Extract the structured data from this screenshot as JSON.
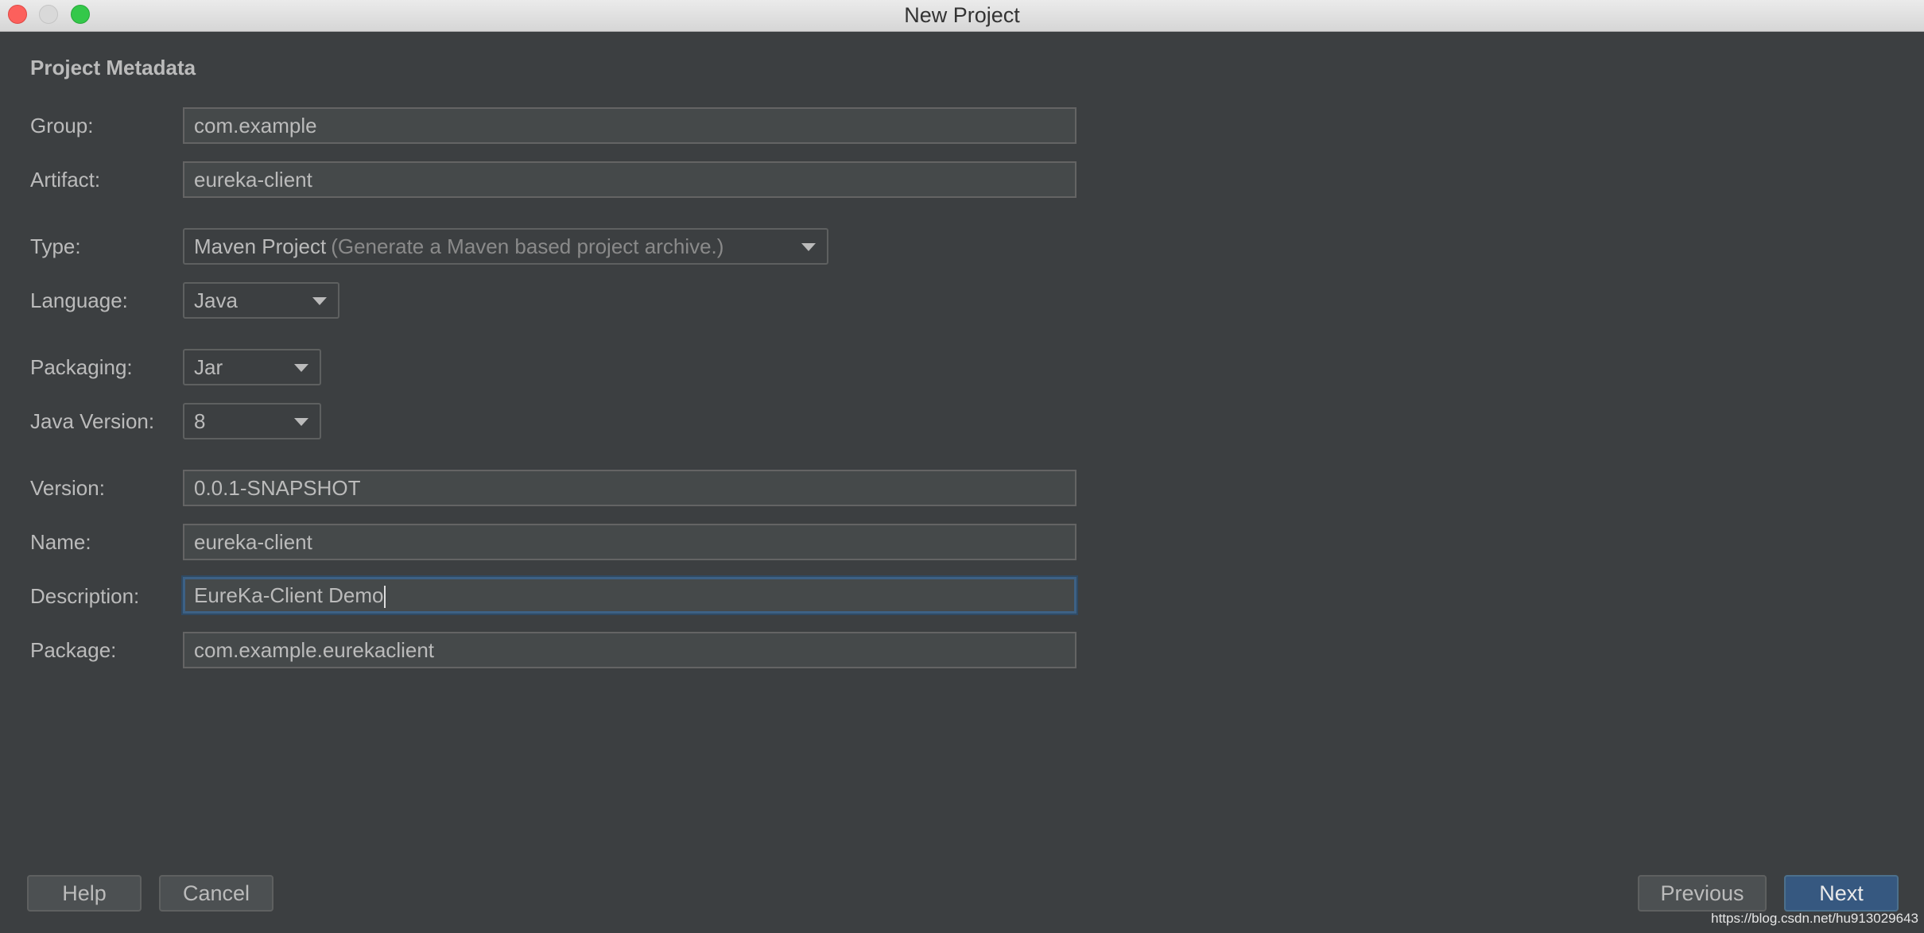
{
  "window": {
    "title": "New Project"
  },
  "section": {
    "title": "Project Metadata"
  },
  "fields": {
    "group": {
      "label": "Group:",
      "value": "com.example"
    },
    "artifact": {
      "label": "Artifact:",
      "value": "eureka-client"
    },
    "type": {
      "label": "Type:",
      "value": "Maven Project",
      "hint": "(Generate a Maven based project archive.)"
    },
    "language": {
      "label": "Language:",
      "value": "Java"
    },
    "packaging": {
      "label": "Packaging:",
      "value": "Jar"
    },
    "java_version": {
      "label": "Java Version:",
      "value": "8"
    },
    "version": {
      "label": "Version:",
      "value": "0.0.1-SNAPSHOT"
    },
    "name": {
      "label": "Name:",
      "value": "eureka-client"
    },
    "description": {
      "label": "Description:",
      "value": "EureKa-Client Demo"
    },
    "package": {
      "label": "Package:",
      "value": "com.example.eurekaclient"
    }
  },
  "buttons": {
    "help": "Help",
    "cancel": "Cancel",
    "previous": "Previous",
    "next": "Next"
  },
  "watermark": "https://blog.csdn.net/hu913029643",
  "colors": {
    "background": "#3c3f41",
    "primary_button": "#365880",
    "focus_border": "#3d6185"
  }
}
